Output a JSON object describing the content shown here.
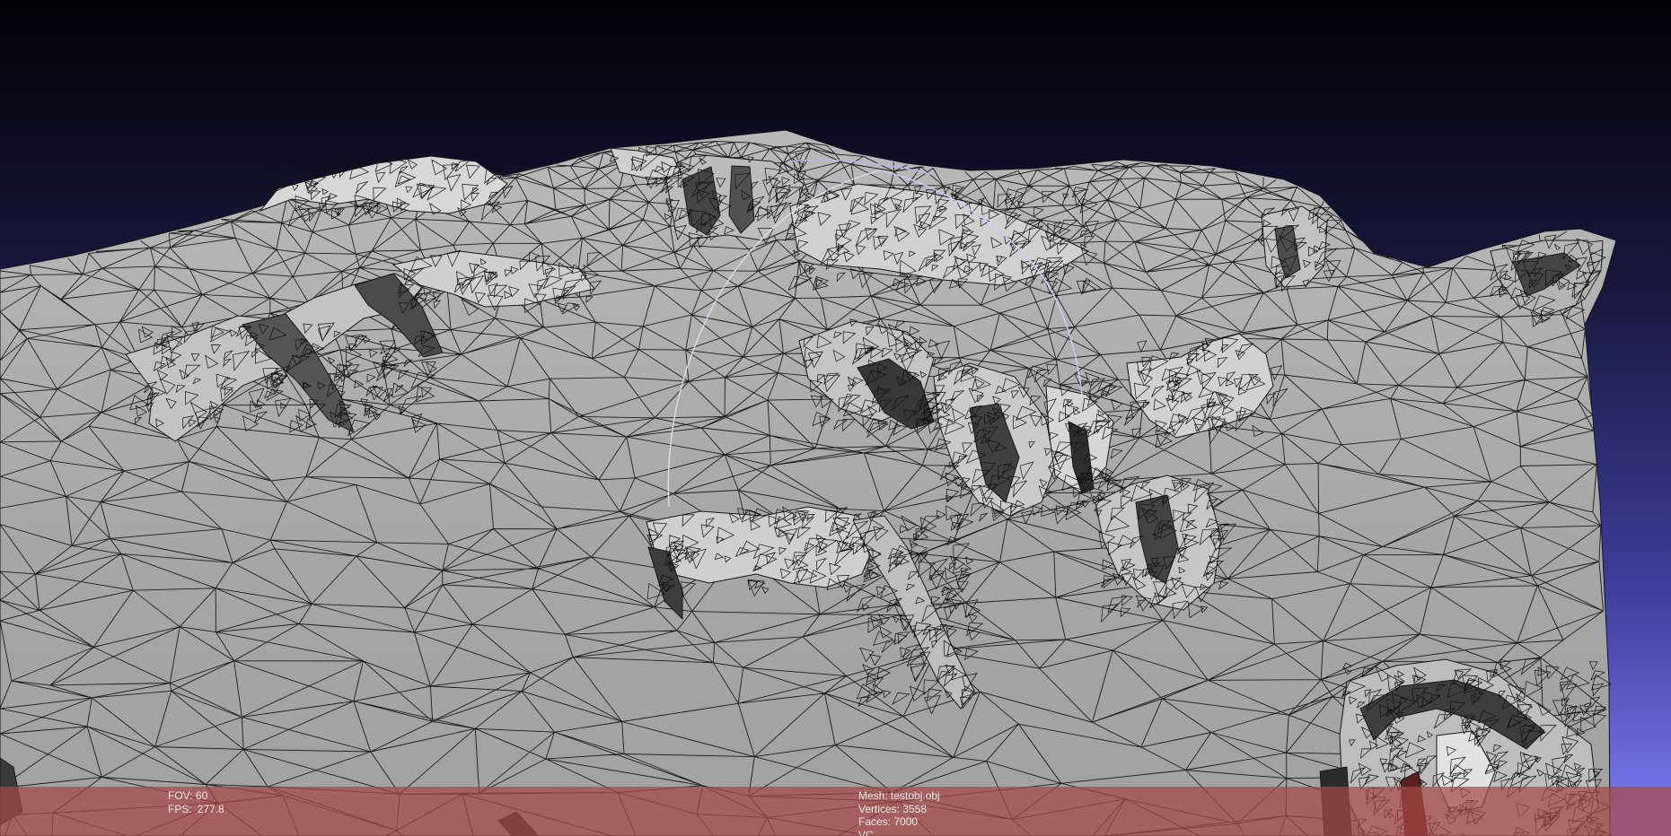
{
  "scene": {
    "background_top_color": "#020207",
    "background_bottom_color": "#7d7ef6",
    "mesh_face_color": "#a8a8a8",
    "mesh_edge_color": "#111111",
    "trackball_color": "#d7c9ff"
  },
  "info_panel": {
    "background_color": "#a84646",
    "fov_label": "FOV:",
    "fov_value": "60",
    "fps_label": "FPS:",
    "fps_value": "277.8",
    "mesh_line": "Mesh: testobj.obj",
    "vertices_line": "Vertices: 3558",
    "faces_line": "Faces: 7000",
    "extra_line": "VC"
  }
}
